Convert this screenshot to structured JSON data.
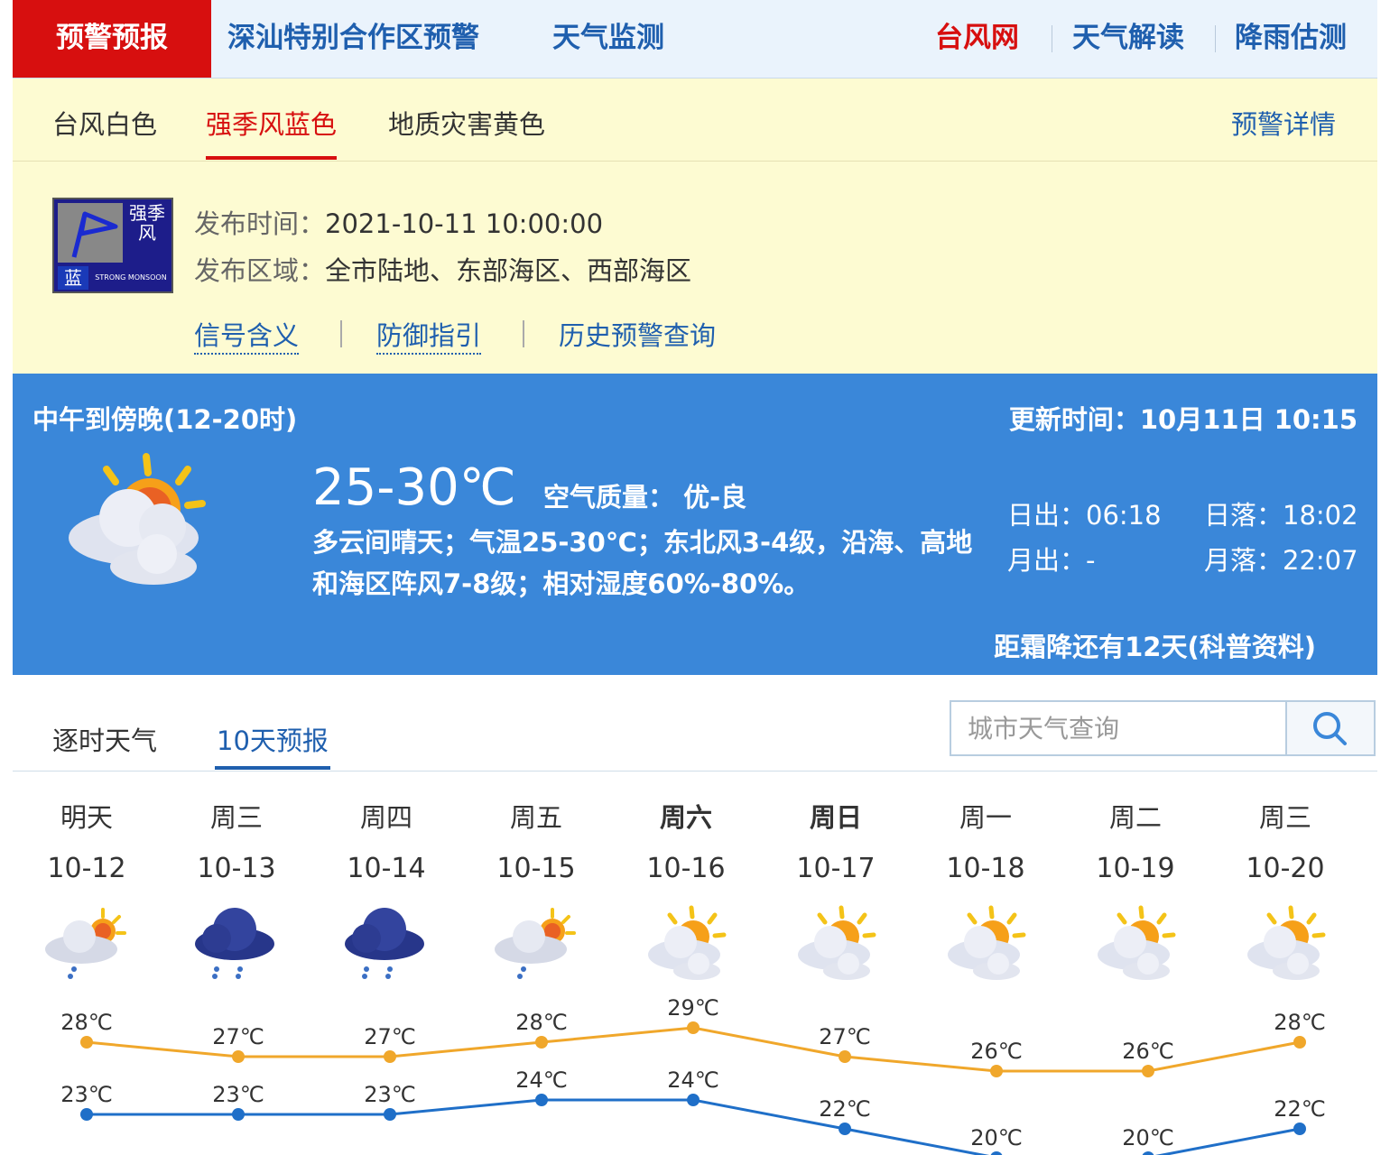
{
  "topnav": {
    "active": "预警预报",
    "items": [
      "深汕特别合作区预警",
      "天气监测"
    ],
    "right": [
      "台风网",
      "天气解读",
      "降雨估测"
    ]
  },
  "warning": {
    "tabs": [
      "台风白色",
      "强季风蓝色",
      "地质灾害黄色"
    ],
    "selected_tab": "强季风蓝色",
    "detail_link": "预警详情",
    "badge": {
      "title": "强季风",
      "level": "蓝",
      "sub": "STRONG MONSOON"
    },
    "time_label": "发布时间：",
    "time_value": "2021-10-11 10:00:00",
    "area_label": "发布区域：",
    "area_value": "全市陆地、东部海区、西部海区",
    "links": [
      "信号含义",
      "防御指引",
      "历史预警查询"
    ]
  },
  "now": {
    "period": "中午到傍晚(12-20时)",
    "update": "更新时间：10月11日 10:15",
    "temp": "25-30℃",
    "air_quality": "空气质量：  优-良",
    "description": "多云间晴天；气温25-30℃；东北风3-4级，沿海、高地和海区阵风7-8级；相对湿度60%-80%。",
    "sunrise": "日出：06:18",
    "sunset": "日落：18:02",
    "moonrise": "月出：-",
    "moonset": "月落：22:07",
    "frost": "距霜降还有12天(科普资料)"
  },
  "forecast": {
    "tabs": [
      "逐时天气",
      "10天预报"
    ],
    "selected_tab": "10天预报",
    "search_placeholder": "城市天气查询",
    "days": [
      {
        "week": "明天",
        "date": "10-12",
        "icon": "partly-cloudy-showers-icon",
        "bold": false
      },
      {
        "week": "周三",
        "date": "10-13",
        "icon": "rain-cloud-icon",
        "bold": false
      },
      {
        "week": "周四",
        "date": "10-14",
        "icon": "rain-cloud-icon",
        "bold": false
      },
      {
        "week": "周五",
        "date": "10-15",
        "icon": "partly-cloudy-showers-icon",
        "bold": false
      },
      {
        "week": "周六",
        "date": "10-16",
        "icon": "partly-cloudy-icon",
        "bold": true
      },
      {
        "week": "周日",
        "date": "10-17",
        "icon": "partly-cloudy-icon",
        "bold": true
      },
      {
        "week": "周一",
        "date": "10-18",
        "icon": "partly-cloudy-icon",
        "bold": false
      },
      {
        "week": "周二",
        "date": "10-19",
        "icon": "partly-cloudy-icon",
        "bold": false
      },
      {
        "week": "周三",
        "date": "10-20",
        "icon": "partly-cloudy-icon",
        "bold": false
      }
    ]
  },
  "chart_data": {
    "type": "line",
    "categories": [
      "10-12",
      "10-13",
      "10-14",
      "10-15",
      "10-16",
      "10-17",
      "10-18",
      "10-19",
      "10-20"
    ],
    "series": [
      {
        "name": "",
        "color": "#f0a72b",
        "values": [
          28,
          27,
          27,
          28,
          29,
          27,
          26,
          26,
          28
        ]
      },
      {
        "name": "",
        "color": "#1f6fc8",
        "values": [
          23,
          23,
          23,
          24,
          24,
          22,
          20,
          20,
          22
        ]
      }
    ],
    "unit": "℃"
  },
  "colors": {
    "red": "#d70f0f",
    "blue": "#1f5fae",
    "panel_blue": "#3a87d9",
    "warn_bg": "#fdfbd2"
  }
}
